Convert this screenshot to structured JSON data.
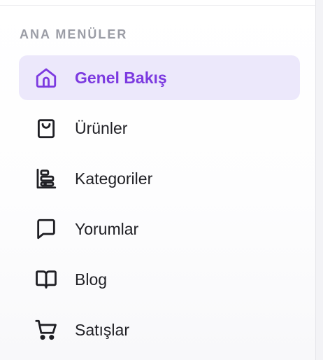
{
  "sidebar": {
    "section_title": "ANA MENÜLER",
    "active_index": 0,
    "accent_color": "#7c3ae0",
    "items": [
      {
        "label": "Genel Bakış",
        "icon": "home-icon",
        "active": true
      },
      {
        "label": "Ürünler",
        "icon": "shopping-bag-icon",
        "active": false
      },
      {
        "label": "Kategoriler",
        "icon": "categories-icon",
        "active": false
      },
      {
        "label": "Yorumlar",
        "icon": "message-icon",
        "active": false
      },
      {
        "label": "Blog",
        "icon": "book-icon",
        "active": false
      },
      {
        "label": "Satışlar",
        "icon": "cart-icon",
        "active": false
      }
    ]
  }
}
